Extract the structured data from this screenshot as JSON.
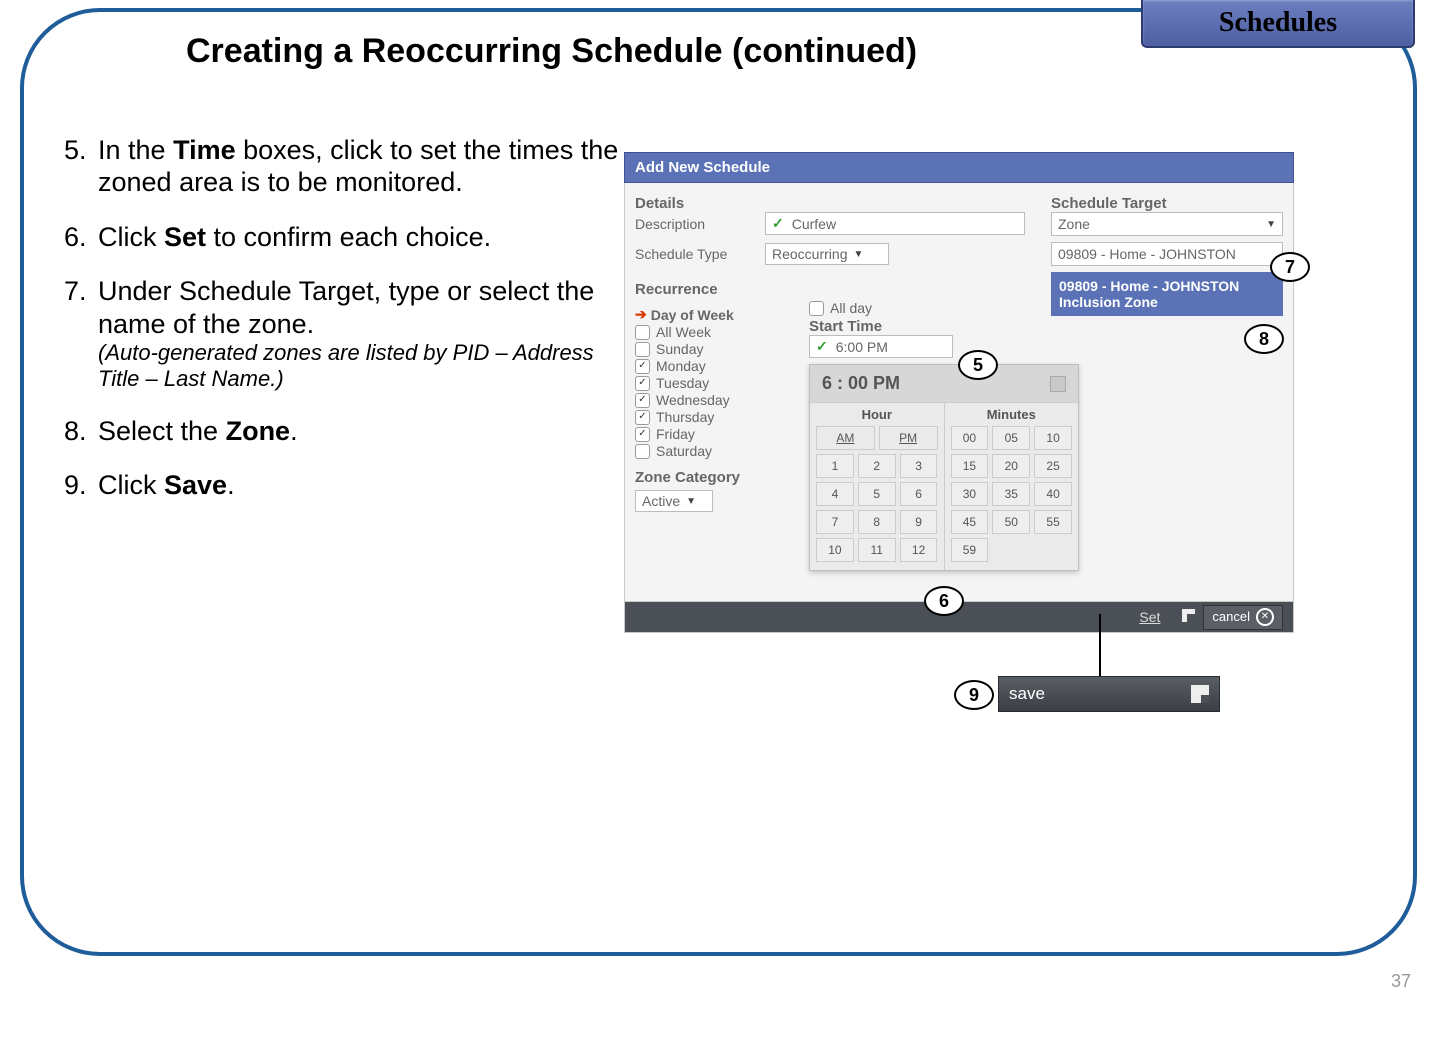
{
  "tab": {
    "label": "Schedules"
  },
  "title": "Creating a Reoccurring Schedule (continued)",
  "instructions": {
    "start_number": 5,
    "items": [
      {
        "html": "In the <b>Time</b> boxes, click to set the times the zoned area is to be monitored."
      },
      {
        "html": "Click <b>Set</b> to confirm each choice."
      },
      {
        "html": "Under Schedule Target, type or select the name of the zone.",
        "note_html": "(<i>Auto-generated zones are listed by PID – Address Title – Last Name</i>.)"
      },
      {
        "html": "Select the <b>Zone</b>."
      },
      {
        "html": "Click <b>Save</b>."
      }
    ]
  },
  "panel": {
    "header": "Add New Schedule",
    "details_label": "Details",
    "description_label": "Description",
    "description_value": "Curfew",
    "schedule_type_label": "Schedule Type",
    "schedule_type_value": "Reoccurring",
    "recurrence_label": "Recurrence",
    "day_of_week_label": "Day of Week",
    "days": [
      {
        "label": "All Week",
        "checked": false
      },
      {
        "label": "Sunday",
        "checked": false
      },
      {
        "label": "Monday",
        "checked": true
      },
      {
        "label": "Tuesday",
        "checked": true
      },
      {
        "label": "Wednesday",
        "checked": true
      },
      {
        "label": "Thursday",
        "checked": true
      },
      {
        "label": "Friday",
        "checked": true
      },
      {
        "label": "Saturday",
        "checked": false
      }
    ],
    "zone_category_label": "Zone Category",
    "zone_category_value": "Active",
    "all_day_label": "All day",
    "start_time_label": "Start Time",
    "start_time_value": "6:00 PM",
    "time_display": "6 : 00 PM",
    "hour_label": "Hour",
    "minutes_label": "Minutes",
    "ampm": [
      "AM",
      "PM"
    ],
    "hours": [
      "1",
      "2",
      "3",
      "4",
      "5",
      "6",
      "7",
      "8",
      "9",
      "10",
      "11",
      "12"
    ],
    "minutes": [
      "00",
      "05",
      "10",
      "15",
      "20",
      "25",
      "30",
      "35",
      "40",
      "45",
      "50",
      "55",
      "59"
    ],
    "set_label": "Set",
    "cancel_label": "cancel",
    "schedule_target_label": "Schedule Target",
    "target_type_value": "Zone",
    "target_name_value": "09809 - Home - JOHNSTON",
    "dropdown_line1": "09809 - Home - JOHNSTON",
    "dropdown_line2": "Inclusion Zone"
  },
  "save": {
    "label": "save"
  },
  "callouts": {
    "c5": "5",
    "c6": "6",
    "c7": "7",
    "c8": "8",
    "c9": "9"
  },
  "page_number": "37"
}
